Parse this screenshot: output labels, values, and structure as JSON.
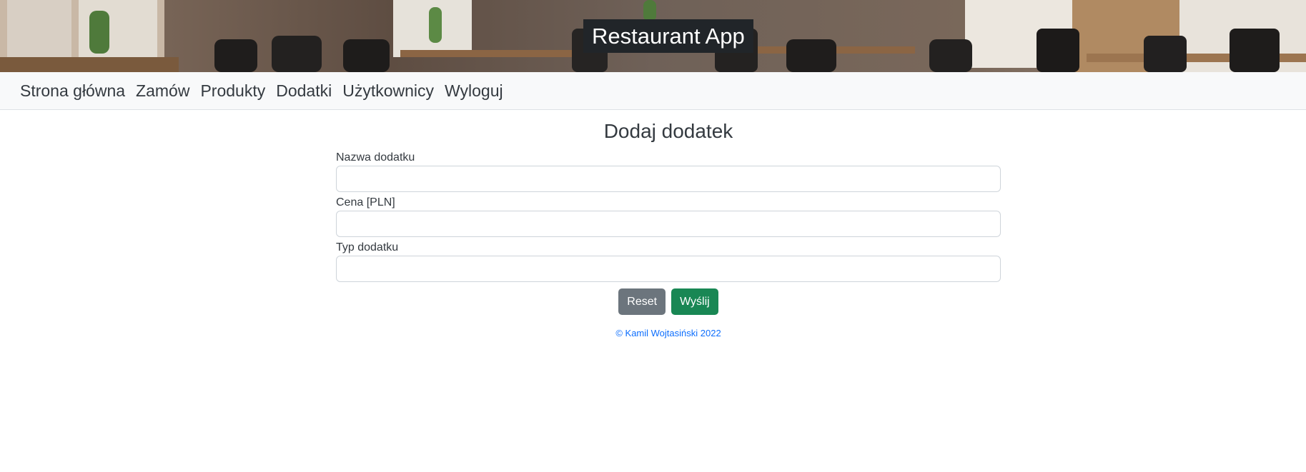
{
  "header": {
    "title": "Restaurant App",
    "banner_image": "restaurant-interior-photo"
  },
  "nav": {
    "items": [
      {
        "label": "Strona główna"
      },
      {
        "label": "Zamów"
      },
      {
        "label": "Produkty"
      },
      {
        "label": "Dodatki"
      },
      {
        "label": "Użytkownicy"
      },
      {
        "label": "Wyloguj"
      }
    ]
  },
  "form": {
    "title": "Dodaj dodatek",
    "fields": [
      {
        "label": "Nazwa dodatku",
        "value": ""
      },
      {
        "label": "Cena [PLN]",
        "value": ""
      },
      {
        "label": "Typ dodatku",
        "value": ""
      }
    ],
    "reset_label": "Reset",
    "submit_label": "Wyślij"
  },
  "footer": {
    "text": "© Kamil Wojtasiński 2022"
  },
  "colors": {
    "navbar_bg": "#f8f9fa",
    "title_bg": "#212529",
    "reset_button": "#6c757d",
    "submit_button": "#198754",
    "footer_link": "#0d6efd"
  }
}
